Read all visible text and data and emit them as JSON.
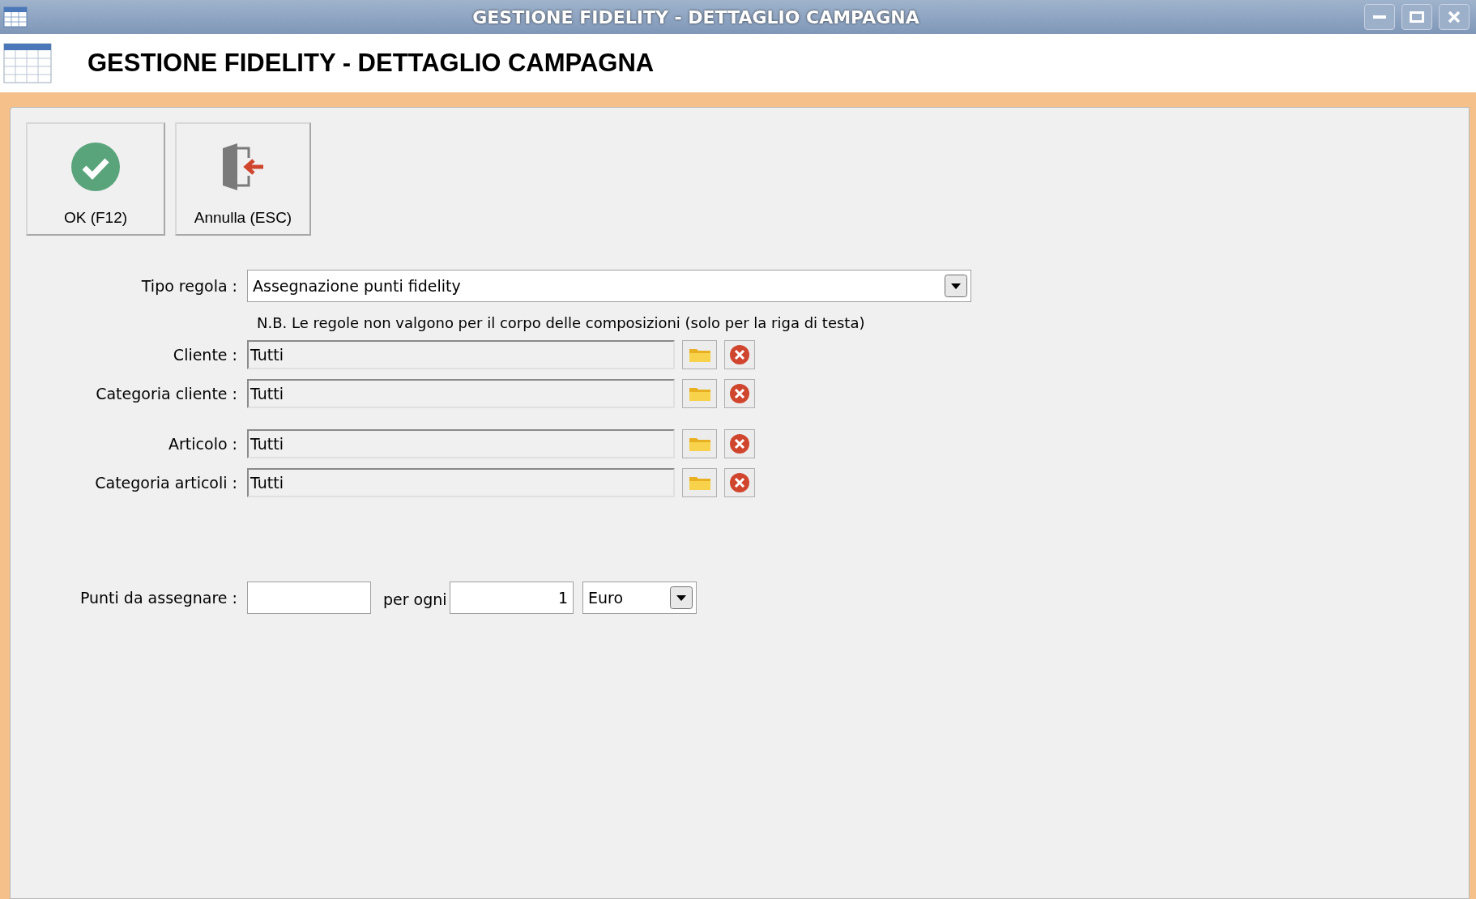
{
  "window": {
    "title": "GESTIONE FIDELITY - DETTAGLIO CAMPAGNA"
  },
  "header": {
    "title": "GESTIONE FIDELITY - DETTAGLIO CAMPAGNA"
  },
  "toolbar": [
    {
      "kind": "ok",
      "label": "OK (F12)"
    },
    {
      "kind": "cancel",
      "label": "Annulla (ESC)"
    }
  ],
  "rule_type": {
    "label": "Tipo regola :",
    "value": "Assegnazione punti fidelity"
  },
  "note": "N.B. Le regole non valgono per il corpo delle composizioni (solo per la riga di testa)",
  "filter_groups": [
    [
      {
        "label": "Cliente :",
        "value": "Tutti"
      },
      {
        "label": "Categoria cliente :",
        "value": "Tutti"
      }
    ],
    [
      {
        "label": "Articolo :",
        "value": "Tutti"
      },
      {
        "label": "Categoria articoli :",
        "value": "Tutti"
      }
    ]
  ],
  "points": {
    "label": "Punti da assegnare :",
    "per_label": "per ogni",
    "amount": "1",
    "unit": "Euro"
  }
}
